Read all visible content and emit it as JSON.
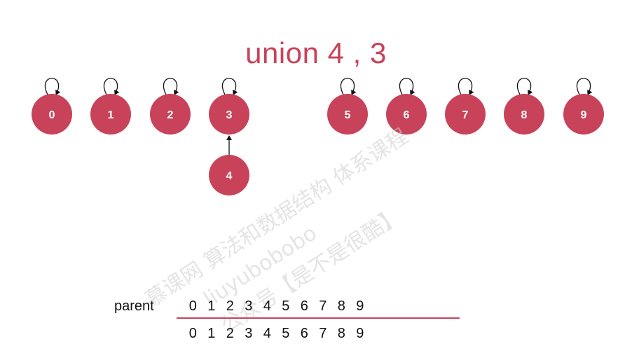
{
  "title": "union 4 , 3",
  "colors": {
    "node": "#c8435a",
    "label": "#ffffff",
    "title": "#c8435a",
    "line": "#111111",
    "divider": "#c8435a"
  },
  "nodes": [
    {
      "id": "0",
      "parent": "0"
    },
    {
      "id": "1",
      "parent": "1"
    },
    {
      "id": "2",
      "parent": "2"
    },
    {
      "id": "3",
      "parent": "3"
    },
    {
      "id": "4",
      "parent": "3"
    },
    {
      "id": "5",
      "parent": "5"
    },
    {
      "id": "6",
      "parent": "6"
    },
    {
      "id": "7",
      "parent": "7"
    },
    {
      "id": "8",
      "parent": "8"
    },
    {
      "id": "9",
      "parent": "9"
    }
  ],
  "parent_array": {
    "label": "parent",
    "index": [
      "0",
      "1",
      "2",
      "3",
      "4",
      "5",
      "6",
      "7",
      "8",
      "9"
    ],
    "values": [
      "0",
      "1",
      "2",
      "3",
      "4",
      "5",
      "6",
      "7",
      "8",
      "9"
    ]
  },
  "watermark": {
    "lines": [
      "慕课网 算法和数据结构 体系课程",
      "liuyubobobo",
      "公众号【是不是很酷】"
    ]
  }
}
